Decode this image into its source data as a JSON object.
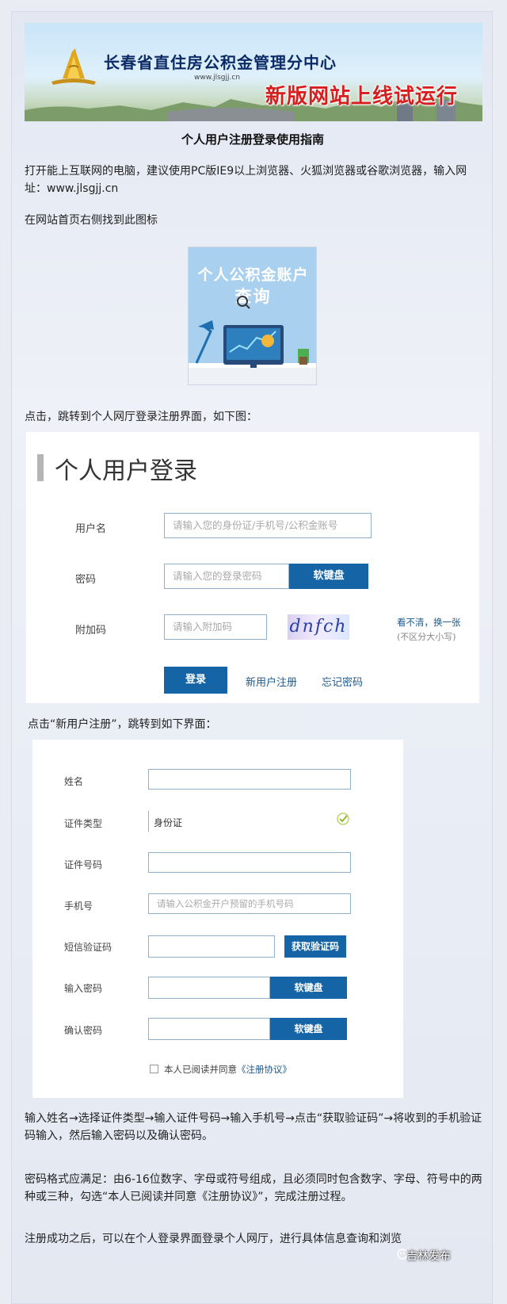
{
  "banner": {
    "org_name": "长春省直住房公积金管理分中心",
    "url": "www.jlsgjj.cn",
    "slogan": "新版网站上线试运行"
  },
  "title": "个人用户注册登录使用指南",
  "paragraphs": {
    "p1": "打开能上互联网的电脑，建议使用PC版IE9以上浏览器、火狐浏览器或谷歌浏览器，输入网址：www.jlsgjj.cn",
    "p2": "在网站首页右侧找到此图标",
    "p3": "点击，跳转到个人网厅登录注册界面，如下图：",
    "p4": "点击“新用户注册”，跳转到如下界面：",
    "p5": "输入姓名→选择证件类型→输入证件号码→输入手机号→点击“获取验证码”→将收到的手机验证码输入，然后输入密码以及确认密码。",
    "p6": "密码格式应满足：由6-16位数字、字母或符号组成，且必须同时包含数字、字母、符号中的两种或三种，勾选“本人已阅读并同意《注册协议》”，完成注册过程。",
    "p7": "注册成功之后，可以在个人登录界面登录个人网厅，进行具体信息查询和浏览"
  },
  "icon_card": {
    "title": "个人公积金账户",
    "subtitle": "查询"
  },
  "login": {
    "heading": "个人用户登录",
    "username_label": "用户名",
    "username_placeholder": "请输入您的身份证/手机号/公积金账号",
    "password_label": "密码",
    "password_placeholder": "请输入您的登录密码",
    "keyboard_label": "软键盘",
    "captcha_label": "附加码",
    "captcha_placeholder": "请输入附加码",
    "captcha_text": "dnfch",
    "refresh_text": "看不清，换一张",
    "case_hint": "(不区分大小写)",
    "login_button": "登录",
    "register_link": "新用户注册",
    "forgot_link": "忘记密码"
  },
  "register": {
    "name_label": "姓名",
    "id_type_label": "证件类型",
    "id_type_value": "身份证",
    "id_number_label": "证件号码",
    "phone_label": "手机号",
    "phone_placeholder": "请输入公积金开户预留的手机号码",
    "sms_label": "短信验证码",
    "sms_button": "获取验证码",
    "password_label": "输入密码",
    "confirm_label": "确认密码",
    "keyboard_label": "软键盘",
    "agree_prefix": "本人已阅读并同意",
    "agree_link": "《注册协议》"
  },
  "watermark": "吉林发布",
  "colors": {
    "primary_button": "#1564a6",
    "slogan": "#d71d1d",
    "org_name": "#0b2a66"
  }
}
